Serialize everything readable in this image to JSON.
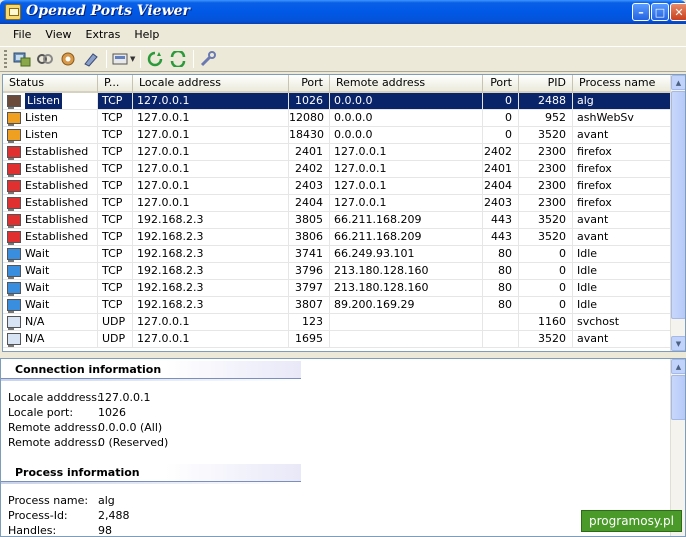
{
  "window": {
    "title": "Opened Ports Viewer"
  },
  "menu": {
    "items": [
      "File",
      "View",
      "Extras",
      "Help"
    ]
  },
  "toolbar": {
    "icons": [
      "refresh-ports-icon",
      "connections-icon",
      "settings-gear-icon",
      "pin-icon",
      "export-icon",
      "reload-icon",
      "auto-refresh-icon",
      "tools-icon"
    ]
  },
  "table": {
    "headers": [
      "Status",
      "P...",
      "Locale address",
      "Port",
      "Remote address",
      "Port",
      "PID",
      "Process name"
    ],
    "rows": [
      {
        "status": "Listen",
        "proto": "TCP",
        "local": "127.0.0.1",
        "lport": "1026",
        "remote": "0.0.0.0",
        "rport": "0",
        "pid": "2488",
        "process": "alg",
        "color": "#6a4a3a",
        "selected": true
      },
      {
        "status": "Listen",
        "proto": "TCP",
        "local": "127.0.0.1",
        "lport": "12080",
        "remote": "0.0.0.0",
        "rport": "0",
        "pid": "952",
        "process": "ashWebSv",
        "color": "#f0a020"
      },
      {
        "status": "Listen",
        "proto": "TCP",
        "local": "127.0.0.1",
        "lport": "18430",
        "remote": "0.0.0.0",
        "rport": "0",
        "pid": "3520",
        "process": "avant",
        "color": "#f0a020"
      },
      {
        "status": "Established",
        "proto": "TCP",
        "local": "127.0.0.1",
        "lport": "2401",
        "remote": "127.0.0.1",
        "rport": "2402",
        "pid": "2300",
        "process": "firefox",
        "color": "#e03030"
      },
      {
        "status": "Established",
        "proto": "TCP",
        "local": "127.0.0.1",
        "lport": "2402",
        "remote": "127.0.0.1",
        "rport": "2401",
        "pid": "2300",
        "process": "firefox",
        "color": "#e03030"
      },
      {
        "status": "Established",
        "proto": "TCP",
        "local": "127.0.0.1",
        "lport": "2403",
        "remote": "127.0.0.1",
        "rport": "2404",
        "pid": "2300",
        "process": "firefox",
        "color": "#e03030"
      },
      {
        "status": "Established",
        "proto": "TCP",
        "local": "127.0.0.1",
        "lport": "2404",
        "remote": "127.0.0.1",
        "rport": "2403",
        "pid": "2300",
        "process": "firefox",
        "color": "#e03030"
      },
      {
        "status": "Established",
        "proto": "TCP",
        "local": "192.168.2.3",
        "lport": "3805",
        "remote": "66.211.168.209",
        "rport": "443",
        "pid": "3520",
        "process": "avant",
        "color": "#e03030"
      },
      {
        "status": "Established",
        "proto": "TCP",
        "local": "192.168.2.3",
        "lport": "3806",
        "remote": "66.211.168.209",
        "rport": "443",
        "pid": "3520",
        "process": "avant",
        "color": "#e03030"
      },
      {
        "status": "Wait",
        "proto": "TCP",
        "local": "192.168.2.3",
        "lport": "3741",
        "remote": "66.249.93.101",
        "rport": "80",
        "pid": "0",
        "process": "Idle",
        "color": "#3a8ee0"
      },
      {
        "status": "Wait",
        "proto": "TCP",
        "local": "192.168.2.3",
        "lport": "3796",
        "remote": "213.180.128.160",
        "rport": "80",
        "pid": "0",
        "process": "Idle",
        "color": "#3a8ee0"
      },
      {
        "status": "Wait",
        "proto": "TCP",
        "local": "192.168.2.3",
        "lport": "3797",
        "remote": "213.180.128.160",
        "rport": "80",
        "pid": "0",
        "process": "Idle",
        "color": "#3a8ee0"
      },
      {
        "status": "Wait",
        "proto": "TCP",
        "local": "192.168.2.3",
        "lport": "3807",
        "remote": "89.200.169.29",
        "rport": "80",
        "pid": "0",
        "process": "Idle",
        "color": "#3a8ee0"
      },
      {
        "status": "N/A",
        "proto": "UDP",
        "local": "127.0.0.1",
        "lport": "123",
        "remote": "",
        "rport": "",
        "pid": "1160",
        "process": "svchost",
        "color": "#d8e4f4"
      },
      {
        "status": "N/A",
        "proto": "UDP",
        "local": "127.0.0.1",
        "lport": "1695",
        "remote": "",
        "rport": "",
        "pid": "3520",
        "process": "avant",
        "color": "#d8e4f4"
      }
    ]
  },
  "connection_info": {
    "title": "Connection information",
    "fields": [
      {
        "label": "Locale adddress:",
        "value": "127.0.0.1"
      },
      {
        "label": "Locale port:",
        "value": "1026"
      },
      {
        "label": "Remote address:",
        "value": "0.0.0.0 (All)"
      },
      {
        "label": "Remote address:",
        "value": "0 (Reserved)"
      }
    ]
  },
  "process_info": {
    "title": "Process information",
    "fields": [
      {
        "label": "Process name:",
        "value": "alg"
      },
      {
        "label": "Process-Id:",
        "value": "2,488"
      },
      {
        "label": "Handles:",
        "value": "98"
      }
    ]
  },
  "watermark": "programosy.pl"
}
